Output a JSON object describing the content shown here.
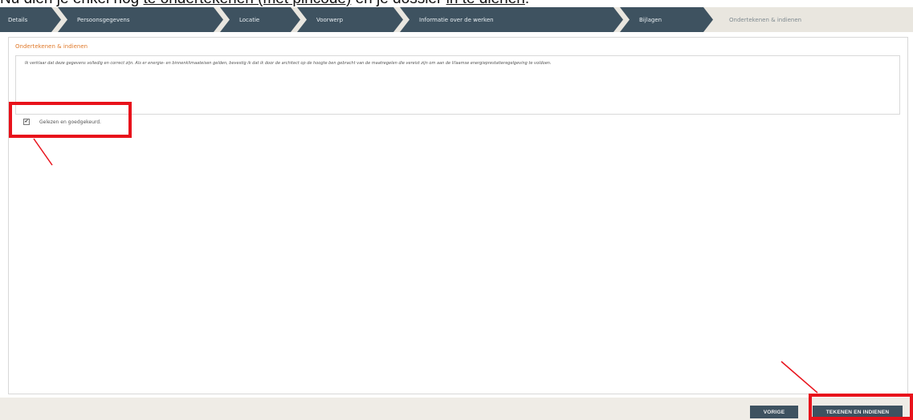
{
  "caption": {
    "prefix": "Nu dien je enkel nog ",
    "link1": "te ondertekenen (met pincode)",
    "middle": " en je dossier ",
    "link2": "in te dienen",
    "suffix": "."
  },
  "steps": [
    {
      "label": "Details"
    },
    {
      "label": "Persoonsgegevens"
    },
    {
      "label": "Locatie"
    },
    {
      "label": "Voorwerp"
    },
    {
      "label": "Informatie over de werken"
    },
    {
      "label": "Bijlagen"
    },
    {
      "label": "Ondertekenen & indienen"
    }
  ],
  "section": {
    "title": "Ondertekenen & indienen",
    "declaration": "Ik verklaar dat deze gegevens volledig en correct zijn. Als er energie- en binnenklimaateisen gelden, bevestig ik dat ik door de architect op de hoogte ben gebracht van de maatregelen die vereist zijn om aan de Vlaamse energieprestatieregelgeving te voldoen.",
    "checkbox_label": "Gelezen en goedgekeurd.",
    "checkbox_checked": true
  },
  "buttons": {
    "previous": "VORIGE",
    "submit": "TEKENEN EN INDIENEN"
  },
  "colors": {
    "step_bg": "#3e5260",
    "active_step_bg": "#e9e6df",
    "accent": "#e07a2b",
    "highlight": "#e8121b"
  }
}
